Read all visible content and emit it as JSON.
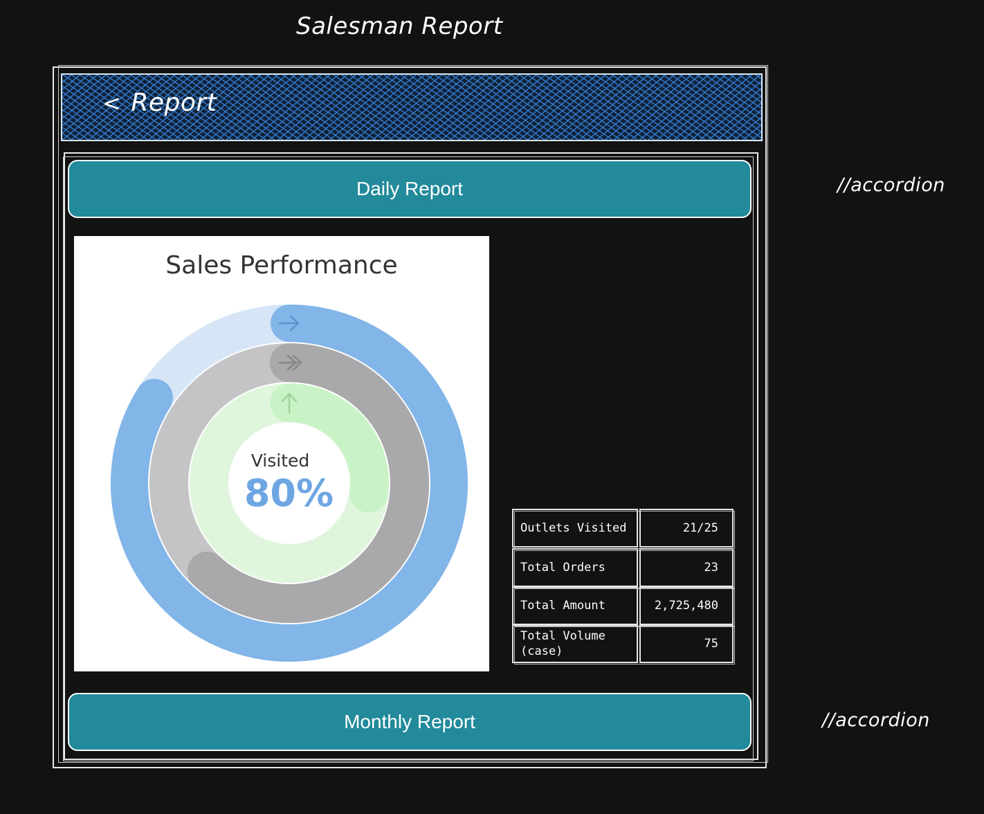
{
  "page": {
    "title": "Salesman Report"
  },
  "header": {
    "back_label": "Report",
    "back_icon": "chevron-left-icon"
  },
  "accordions": {
    "daily": {
      "label": "Daily Report",
      "annotation": "//accordion"
    },
    "monthly": {
      "label": "Monthly Report",
      "annotation": "//accordion"
    }
  },
  "chart": {
    "title": "Sales Performance",
    "center_label": "Visited",
    "center_value": "80%"
  },
  "chart_data": {
    "type": "radial-progress",
    "title": "Sales Performance",
    "center_label": "Visited",
    "center_value": "80%",
    "rings": [
      {
        "ring": "outer",
        "value": 0.84,
        "color": "#82b5e8",
        "track_color": "#d6e6f7",
        "icon": "arrow-right-icon"
      },
      {
        "ring": "middle",
        "value": 0.62,
        "color": "#a9a9ab",
        "track_color": "#c4c4c6",
        "icon": "double-arrow-right-icon"
      },
      {
        "ring": "inner",
        "value": 0.27,
        "color": "#c9f3c7",
        "track_color": "#dff6dd",
        "icon": "arrow-up-icon"
      }
    ]
  },
  "stats": [
    {
      "label": "Outlets Visited",
      "value": "21/25"
    },
    {
      "label": "Total Orders",
      "value": "23"
    },
    {
      "label": "Total Amount",
      "value": "2,725,480"
    },
    {
      "label": "Total Volume (case)",
      "value": "75"
    }
  ],
  "colors": {
    "background": "#121212",
    "accordion": "#228a9a",
    "header_hatch": "#347acc",
    "center_value": "#6ea6e3"
  }
}
